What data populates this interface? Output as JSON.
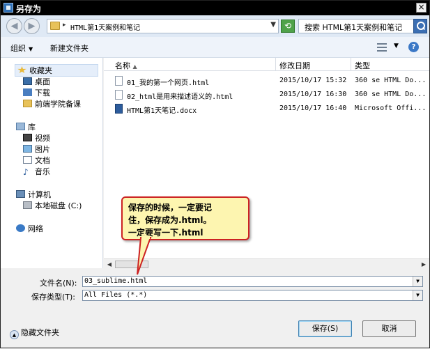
{
  "window": {
    "title": "另存为",
    "close_glyph": "×"
  },
  "address": {
    "path": "HTML第1天案例和笔记",
    "search_placeholder": "搜索 HTML第1天案例和笔记"
  },
  "toolbar": {
    "organize_label": "组织",
    "new_folder_label": "新建文件夹",
    "help_glyph": "?"
  },
  "nav": {
    "favorites": {
      "label": "收藏夹",
      "items": [
        "桌面",
        "下载",
        "前端学院备课"
      ]
    },
    "libraries": {
      "label": "库",
      "items": [
        "视频",
        "图片",
        "文档",
        "音乐"
      ]
    },
    "computer": {
      "label": "计算机",
      "items": [
        "本地磁盘 (C:)"
      ]
    },
    "network": {
      "label": "网络"
    }
  },
  "columns": {
    "name": "名称",
    "date": "修改日期",
    "type": "类型"
  },
  "files": [
    {
      "name": "01_我的第一个网页.html",
      "date": "2015/10/17 15:32",
      "type": "360 se HTML Do..."
    },
    {
      "name": "02_html是用来描述语义的.html",
      "date": "2015/10/17 16:30",
      "type": "360 se HTML Do..."
    },
    {
      "name": "HTML第1天笔记.docx",
      "date": "2015/10/17 16:40",
      "type": "Microsoft Offi..."
    }
  ],
  "fields": {
    "filename_label": "文件名(N):",
    "filename_value": "03_sublime.html",
    "filetype_label": "保存类型(T):",
    "filetype_value": "All Files (*.*)"
  },
  "buttons": {
    "hide_folders": "隐藏文件夹",
    "save": "保存(S)",
    "cancel": "取消"
  },
  "callout": {
    "line1": "保存的时候，一定要记",
    "line2": "住，保存成为.html。",
    "line3": "一定要写一下.html"
  },
  "colors": {
    "callout_border": "#cc2222",
    "callout_fill": "#fdf5b0",
    "titlebar": "#000000"
  }
}
